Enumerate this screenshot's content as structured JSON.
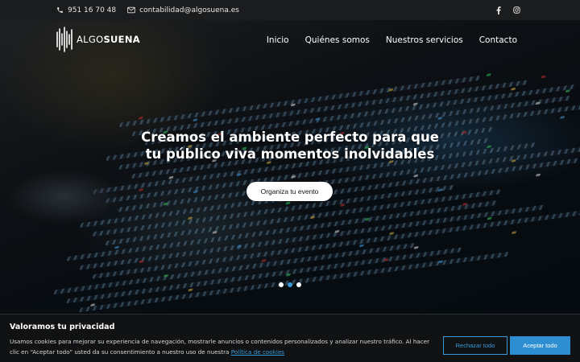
{
  "topbar": {
    "phone": "951 16 70 48",
    "email": "contabilidad@algosuena.es",
    "phone_icon": "phone-icon",
    "email_icon": "envelope-icon",
    "social": [
      "facebook-icon",
      "instagram-icon"
    ]
  },
  "header": {
    "logo_text_light": "ALGO",
    "logo_text_bold": "SUENA",
    "nav": [
      "Inicio",
      "Quiénes somos",
      "Nuestros servicios",
      "Contacto"
    ]
  },
  "hero": {
    "headline_line1": "Creamos el ambiente perfecto para que",
    "headline_line2": "tu público viva momentos inolvidables",
    "cta_label": "Organiza tu evento",
    "slides_count": 3,
    "active_slide": 2
  },
  "cookie": {
    "title": "Valoramos tu privacidad",
    "text": "Usamos cookies para mejorar su experiencia de navegación, mostrarle anuncios o contenidos personalizados y analizar nuestro tráfico. Al hacer clic en “Aceptar todo” usted da su consentimiento a nuestro uso de nuestra ",
    "policy_link": "Política de cookies",
    "reject_label": "Rechazar todo",
    "accept_label": "Aceptar todo"
  },
  "colors": {
    "accent": "#3a9ad9",
    "topbar_bg": "#1b1c1e",
    "cookie_bg": "#101214"
  }
}
